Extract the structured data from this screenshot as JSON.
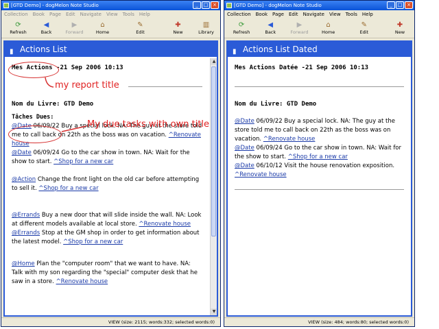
{
  "left_window": {
    "title": "[GTD Demo] - dogMelon Note Studio",
    "menu": [
      "Collection",
      "Book",
      "Page",
      "Edit",
      "Navigate",
      "View",
      "Tools",
      "Help"
    ],
    "toolbar": [
      {
        "label": "Refresh",
        "icon": "refresh-icon"
      },
      {
        "label": "Back",
        "icon": "back-arrow-icon"
      },
      {
        "label": "Forward",
        "icon": "forward-arrow-icon",
        "disabled": true
      },
      {
        "label": "Home",
        "icon": "home-icon"
      },
      {
        "label": "Edit",
        "icon": "pencil-icon"
      },
      {
        "label": "New",
        "icon": "new-document-icon"
      },
      {
        "label": "Library",
        "icon": "library-icon"
      }
    ],
    "panel_title": "Actions List",
    "report_title": "Mes Actions -21 Sep 2006 10:13",
    "book_title": "Nom du Livre: GTD Demo",
    "section_title": "Tâches Dues:",
    "entries": [
      {
        "tag": "@Date",
        "text": " 06/09/22 Buy a special lock. NA: The guy at the store told me to call back on 22th as the boss was on vacation.",
        "link": "^Renovate house"
      },
      {
        "tag": "@Date",
        "text": " 06/09/24 Go to the car show in town. NA: Wait for the show to start.",
        "link": "^Shop for a new car"
      },
      {
        "tag": "@Action",
        "text": " Change the front light on the old car before attempting to sell it.",
        "link": "^Shop for a new car"
      },
      {
        "tag": "@Errands",
        "text": " Buy a new door that will slide inside the wall. NA: Look at different models available at local store.",
        "link": "^Renovate house"
      },
      {
        "tag": "@Errands",
        "text": " Stop at the GM shop in order to get information about the latest model.",
        "link": "^Shop for a new car"
      },
      {
        "tag": "@Home",
        "text": " Plan the \"computer room\" that we want to have. NA: Talk with my son regarding the \"special\" computer desk that he saw in a store.",
        "link": "^Renovate house"
      }
    ],
    "status": "VIEW (size: 2115; words:332; selected words:0)"
  },
  "right_window": {
    "title": "[GTD Demo] - dogMelon Note Studio",
    "menu": [
      "Collection",
      "Book",
      "Page",
      "Edit",
      "Navigate",
      "View",
      "Tools",
      "Help"
    ],
    "toolbar": [
      {
        "label": "Refresh",
        "icon": "refresh-icon"
      },
      {
        "label": "Back",
        "icon": "back-arrow-icon"
      },
      {
        "label": "Forward",
        "icon": "forward-arrow-icon",
        "disabled": true
      },
      {
        "label": "Home",
        "icon": "home-icon"
      },
      {
        "label": "Edit",
        "icon": "pencil-icon"
      },
      {
        "label": "New",
        "icon": "new-document-icon"
      }
    ],
    "panel_title": "Actions List Dated",
    "report_title": "Mes Actions Datée -21 Sep 2006 10:13",
    "book_title": "Nom du Livre: GTD Demo",
    "entries": [
      {
        "tag": "@Date",
        "text": " 06/09/22 Buy a special lock. NA: The guy at the store told me to call back on 22th as the boss was on vacation.",
        "link": "^Renovate house"
      },
      {
        "tag": "@Date",
        "text": " 06/09/24 Go to the car show in town. NA: Wait for the show to start.",
        "link": "^Shop for a new car"
      },
      {
        "tag": "@Date",
        "text": " 06/10/12 Visit the house renovation exposition.",
        "link": "^Renovate house"
      }
    ],
    "status": "VIEW (size: 484; words:80; selected words:0)"
  },
  "annotations": {
    "report_title_note": "my report title",
    "due_tasks_note": "My due tasks with own title",
    "color": "#e02020"
  }
}
